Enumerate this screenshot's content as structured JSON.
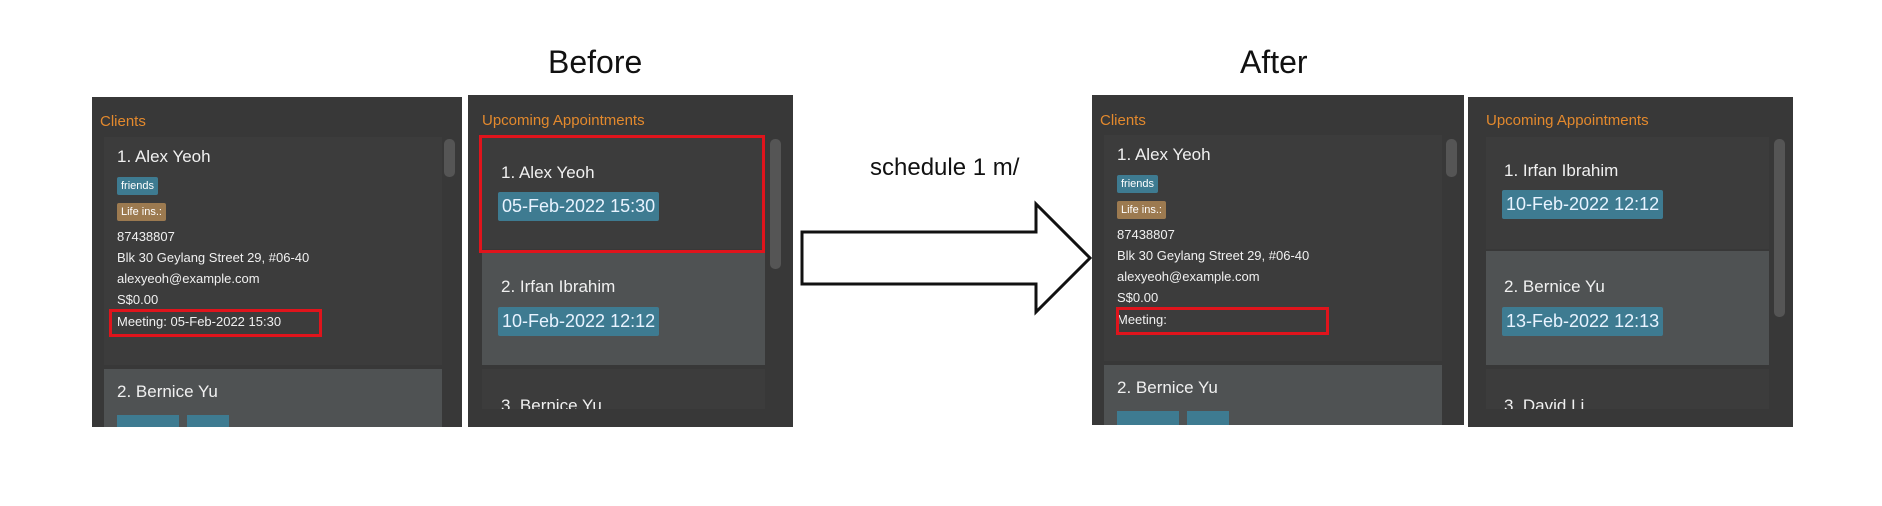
{
  "headings": {
    "before": "Before",
    "after": "After"
  },
  "command": "schedule 1 m/",
  "before": {
    "clients_title": "Clients",
    "appointments_title": "Upcoming Appointments",
    "client1": {
      "name": "1.  Alex Yeoh",
      "tag_friends": "friends",
      "tag_plan": "Life ins.:",
      "phone": "87438807",
      "address": "Blk 30 Geylang Street 29, #06-40",
      "email": "alexyeoh@example.com",
      "amount": "S$0.00",
      "meeting": "Meeting: 05-Feb-2022 15:30"
    },
    "client2": {
      "name": "2.  Bernice Yu"
    },
    "appointments": [
      {
        "name": "1.  Alex Yeoh",
        "date": "05-Feb-2022 15:30"
      },
      {
        "name": "2.  Irfan Ibrahim",
        "date": "10-Feb-2022 12:12"
      },
      {
        "name": "3.  Bernice Yu"
      }
    ]
  },
  "after": {
    "clients_title": "Clients",
    "appointments_title": "Upcoming Appointments",
    "client1": {
      "name": "1.  Alex Yeoh",
      "tag_friends": "friends",
      "tag_plan": "Life ins.:",
      "phone": "87438807",
      "address": "Blk 30 Geylang Street 29, #06-40",
      "email": "alexyeoh@example.com",
      "amount": "S$0.00",
      "meeting": "Meeting:"
    },
    "client2": {
      "name": "2.  Bernice Yu"
    },
    "appointments": [
      {
        "name": "1.  Irfan Ibrahim",
        "date": "10-Feb-2022 12:12"
      },
      {
        "name": "2.  Bernice Yu",
        "date": "13-Feb-2022 12:13"
      },
      {
        "name": "3.  David Li"
      }
    ]
  },
  "colors": {
    "panel": "#383838",
    "accent_title": "#e3892d",
    "tag_blue": "#3e7b91",
    "tag_brown": "#9c7a50",
    "highlight": "#e0141c"
  },
  "icons": {
    "arrow": "right-arrow-icon"
  }
}
